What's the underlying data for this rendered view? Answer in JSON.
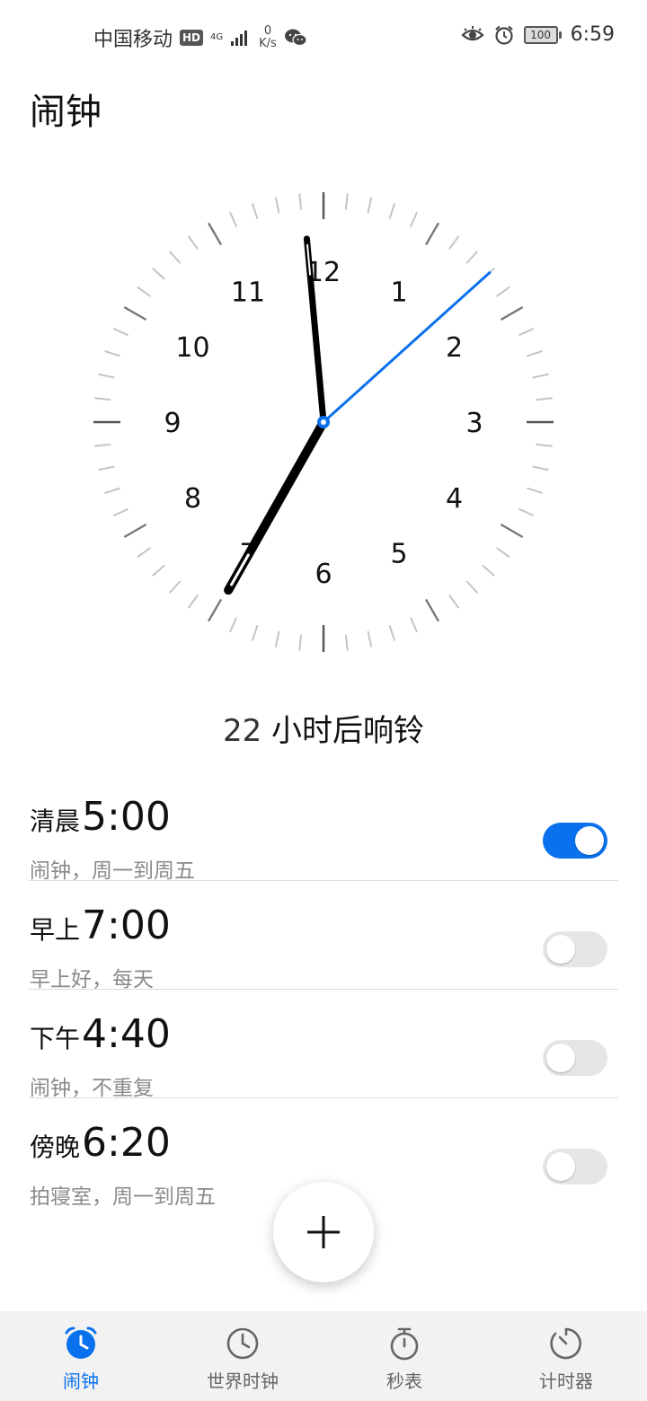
{
  "status": {
    "carrier": "中国移动",
    "hd_badge": "HD",
    "network": "4G",
    "speed_value": "0",
    "speed_unit": "K/s",
    "battery": "100",
    "time": "6:59"
  },
  "title": "闹钟",
  "clock": {
    "numbers": [
      "12",
      "1",
      "2",
      "3",
      "4",
      "5",
      "6",
      "7",
      "8",
      "9",
      "10",
      "11"
    ],
    "hour": 6,
    "minute": 59,
    "second": 8,
    "accent": "#0a71ee"
  },
  "next_ring": {
    "count": "22",
    "text": "小时后响铃"
  },
  "alarms": [
    {
      "period": "清晨",
      "time": "5:00",
      "sub": "闹钟，周一到周五",
      "enabled": true
    },
    {
      "period": "早上",
      "time": "7:00",
      "sub": "早上好，每天",
      "enabled": false
    },
    {
      "period": "下午",
      "time": "4:40",
      "sub": "闹钟，不重复",
      "enabled": false
    },
    {
      "period": "傍晚",
      "time": "6:20",
      "sub": "拍寝室，周一到周五",
      "enabled": false
    }
  ],
  "nav": {
    "active_color": "#0a71ee",
    "items": [
      {
        "label": "闹钟",
        "icon": "alarm-clock-icon",
        "active": true
      },
      {
        "label": "世界时钟",
        "icon": "world-clock-icon",
        "active": false
      },
      {
        "label": "秒表",
        "icon": "stopwatch-icon",
        "active": false
      },
      {
        "label": "计时器",
        "icon": "timer-icon",
        "active": false
      }
    ]
  }
}
